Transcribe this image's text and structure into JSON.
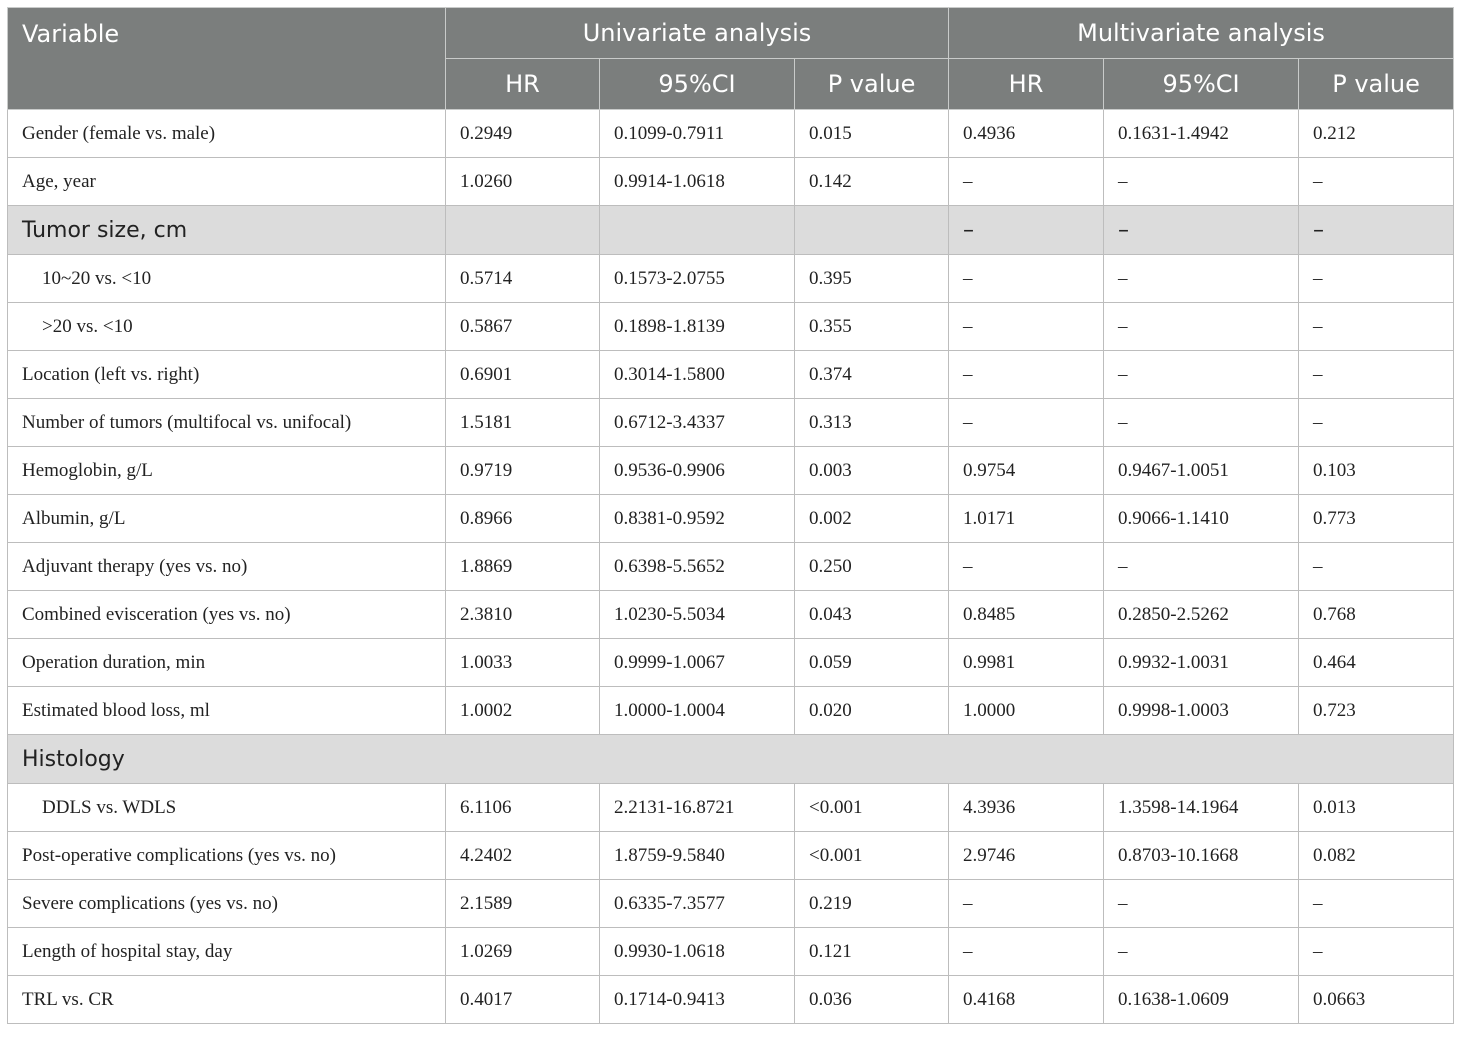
{
  "header": {
    "variable": "Variable",
    "univariate": "Univariate analysis",
    "multivariate": "Multivariate analysis",
    "hr": "HR",
    "ci": "95%CI",
    "p": "P value"
  },
  "rows": [
    {
      "label": "Gender (female vs. male)",
      "u_hr": "0.2949",
      "u_ci": "0.1099-0.7911",
      "u_p": "0.015",
      "m_hr": "0.4936",
      "m_ci": "0.1631-1.4942",
      "m_p": "0.212"
    },
    {
      "label": "Age, year",
      "u_hr": "1.0260",
      "u_ci": "0.9914-1.0618",
      "u_p": "0.142",
      "m_hr": "–",
      "m_ci": "–",
      "m_p": "–"
    },
    {
      "label": "Tumor size, cm",
      "u_hr": "",
      "u_ci": "",
      "u_p": "",
      "m_hr": "–",
      "m_ci": "–",
      "m_p": "–"
    },
    {
      "label": "10~20 vs. <10",
      "u_hr": "0.5714",
      "u_ci": "0.1573-2.0755",
      "u_p": "0.395",
      "m_hr": "–",
      "m_ci": "–",
      "m_p": "–"
    },
    {
      "label": ">20 vs. <10",
      "u_hr": "0.5867",
      "u_ci": "0.1898-1.8139",
      "u_p": "0.355",
      "m_hr": "–",
      "m_ci": "–",
      "m_p": "–"
    },
    {
      "label": "Location (left vs. right)",
      "u_hr": "0.6901",
      "u_ci": "0.3014-1.5800",
      "u_p": "0.374",
      "m_hr": "–",
      "m_ci": "–",
      "m_p": "–"
    },
    {
      "label": "Number of tumors (multifocal vs. unifocal)",
      "u_hr": "1.5181",
      "u_ci": "0.6712-3.4337",
      "u_p": "0.313",
      "m_hr": "–",
      "m_ci": "–",
      "m_p": "–"
    },
    {
      "label": "Hemoglobin, g/L",
      "u_hr": "0.9719",
      "u_ci": "0.9536-0.9906",
      "u_p": "0.003",
      "m_hr": "0.9754",
      "m_ci": "0.9467-1.0051",
      "m_p": "0.103"
    },
    {
      "label": "Albumin, g/L",
      "u_hr": "0.8966",
      "u_ci": "0.8381-0.9592",
      "u_p": "0.002",
      "m_hr": "1.0171",
      "m_ci": "0.9066-1.1410",
      "m_p": "0.773"
    },
    {
      "label": "Adjuvant therapy (yes vs. no)",
      "u_hr": "1.8869",
      "u_ci": "0.6398-5.5652",
      "u_p": "0.250",
      "m_hr": "–",
      "m_ci": "–",
      "m_p": "–"
    },
    {
      "label": "Combined evisceration (yes vs. no)",
      "u_hr": "2.3810",
      "u_ci": "1.0230-5.5034",
      "u_p": "0.043",
      "m_hr": "0.8485",
      "m_ci": "0.2850-2.5262",
      "m_p": "0.768"
    },
    {
      "label": "Operation duration, min",
      "u_hr": "1.0033",
      "u_ci": "0.9999-1.0067",
      "u_p": "0.059",
      "m_hr": "0.9981",
      "m_ci": "0.9932-1.0031",
      "m_p": "0.464"
    },
    {
      "label": "Estimated blood loss, ml",
      "u_hr": "1.0002",
      "u_ci": "1.0000-1.0004",
      "u_p": "0.020",
      "m_hr": "1.0000",
      "m_ci": "0.9998-1.0003",
      "m_p": "0.723"
    },
    {
      "label": "Histology"
    },
    {
      "label": "DDLS vs. WDLS",
      "u_hr": "6.1106",
      "u_ci": "2.2131-16.8721",
      "u_p": "<0.001",
      "m_hr": "4.3936",
      "m_ci": "1.3598-14.1964",
      "m_p": "0.013"
    },
    {
      "label": "Post-operative complications (yes vs. no)",
      "u_hr": "4.2402",
      "u_ci": "1.8759-9.5840",
      "u_p": "<0.001",
      "m_hr": "2.9746",
      "m_ci": "0.8703-10.1668",
      "m_p": "0.082"
    },
    {
      "label": "Severe complications (yes vs. no)",
      "u_hr": "2.1589",
      "u_ci": "0.6335-7.3577",
      "u_p": "0.219",
      "m_hr": "–",
      "m_ci": "–",
      "m_p": "–"
    },
    {
      "label": "Length of hospital stay, day",
      "u_hr": "1.0269",
      "u_ci": "0.9930-1.0618",
      "u_p": "0.121",
      "m_hr": "–",
      "m_ci": "–",
      "m_p": "–"
    },
    {
      "label": "TRL vs. CR",
      "u_hr": "0.4017",
      "u_ci": "0.1714-0.9413",
      "u_p": "0.036",
      "m_hr": "0.4168",
      "m_ci": "0.1638-1.0609",
      "m_p": "0.0663"
    }
  ]
}
